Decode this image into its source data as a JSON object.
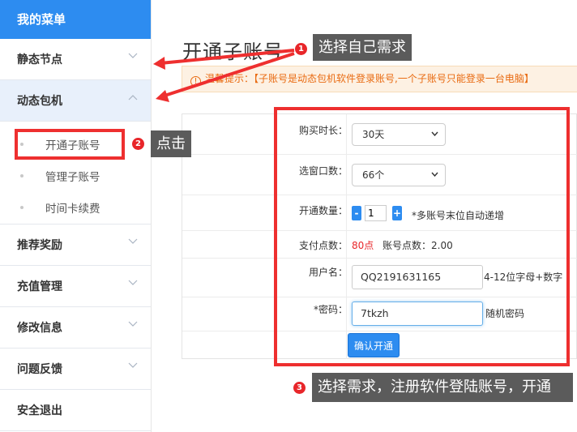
{
  "sidebar": {
    "header": "我的菜单",
    "items": [
      {
        "label": "静态节点"
      },
      {
        "label": "动态包机"
      },
      {
        "label": "推荐奖励"
      },
      {
        "label": "充值管理"
      },
      {
        "label": "修改信息"
      },
      {
        "label": "问题反馈"
      },
      {
        "label": "安全退出"
      }
    ],
    "submenu": [
      {
        "label": "开通子账号"
      },
      {
        "label": "管理子账号"
      },
      {
        "label": "时间卡续费"
      }
    ]
  },
  "main": {
    "title": "开通子账号",
    "notice": "温馨提示：【子账号是动态包机软件登录账号,一个子账号只能登录一台电脑】",
    "form": {
      "duration_label": "购买时长：",
      "duration_value": "30天",
      "windows_label": "选窗口数：",
      "windows_value": "66个",
      "quantity_label": "开通数量：",
      "quantity_value": "1",
      "quantity_minus": "-",
      "quantity_plus": "+",
      "quantity_hint": "*多账号末位自动递增",
      "pay_label": "支付点数：",
      "pay_value": "80点",
      "balance_text": "账号点数：2.00",
      "username_label": "用户名：",
      "username_value": "QQ2191631165",
      "username_hint": "4-12位字母+数字",
      "password_label": "*密码：",
      "password_value": "7tkzh",
      "password_hint": "随机密码",
      "submit_label": "确认开通"
    }
  },
  "annotations": {
    "step1_num": "1",
    "step1_text": "选择自己需求",
    "step2_num": "2",
    "step2_text": "点击",
    "step3_num": "3",
    "step3_text": "选择需求，注册软件登陆账号，开通"
  },
  "colors": {
    "accent": "#2d8cf0",
    "annotation_red": "#ee2f2f",
    "notice_orange": "#e96b12",
    "pay_red": "#e8262a"
  }
}
